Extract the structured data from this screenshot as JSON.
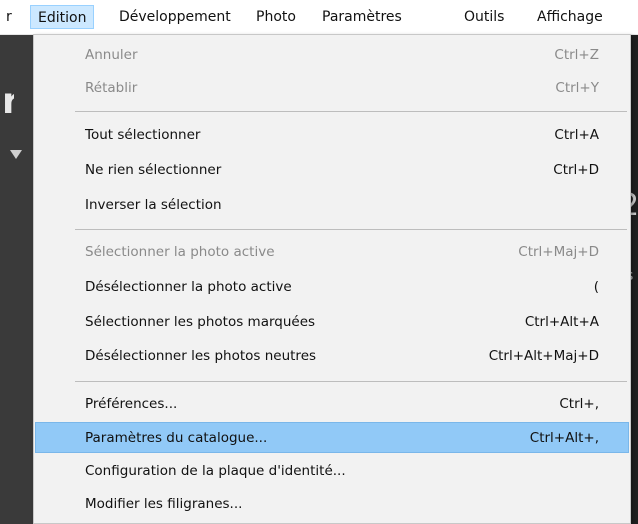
{
  "menubar": {
    "items": [
      {
        "label": "r"
      },
      {
        "label": "Edition"
      },
      {
        "label": "Développement"
      },
      {
        "label": "Photo"
      },
      {
        "label": "Paramètres"
      },
      {
        "label": "Outils"
      },
      {
        "label": "Affichage"
      }
    ]
  },
  "menu": {
    "items": [
      {
        "label": "Annuler",
        "shortcut": "Ctrl+Z",
        "enabled": false
      },
      {
        "label": "Rétablir",
        "shortcut": "Ctrl+Y",
        "enabled": false
      },
      {
        "label": "Tout sélectionner",
        "shortcut": "Ctrl+A",
        "enabled": true
      },
      {
        "label": "Ne rien sélectionner",
        "shortcut": "Ctrl+D",
        "enabled": true
      },
      {
        "label": "Inverser la sélection",
        "shortcut": "",
        "enabled": true
      },
      {
        "label": "Sélectionner la photo active",
        "shortcut": "Ctrl+Maj+D",
        "enabled": false
      },
      {
        "label": "Désélectionner la photo active",
        "shortcut": "(",
        "enabled": true
      },
      {
        "label": "Sélectionner les photos marquées",
        "shortcut": "Ctrl+Alt+A",
        "enabled": true
      },
      {
        "label": "Désélectionner les photos neutres",
        "shortcut": "Ctrl+Alt+Maj+D",
        "enabled": true
      },
      {
        "label": "Préférences...",
        "shortcut": "Ctrl+,",
        "enabled": true
      },
      {
        "label": "Paramètres du catalogue...",
        "shortcut": "Ctrl+Alt+,",
        "enabled": true,
        "highlighted": true
      },
      {
        "label": "Configuration de la plaque d'identité...",
        "shortcut": "",
        "enabled": true
      },
      {
        "label": "Modifier les filigranes...",
        "shortcut": "",
        "enabled": true
      }
    ]
  },
  "background": {
    "left_glyph": "r",
    "right_glyph": "2",
    "right_mark": "s"
  },
  "colors": {
    "menu_bg": "#f2f2f2",
    "highlight": "#91c9f7",
    "menubar_active": "#cce8ff",
    "app_bg": "#262626",
    "disabled_text": "#8a8a8a"
  }
}
